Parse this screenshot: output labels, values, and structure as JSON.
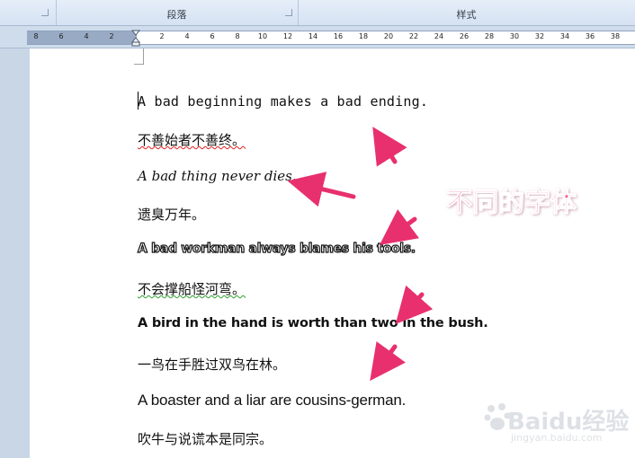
{
  "ribbon": {
    "groups": [
      {
        "label": ""
      },
      {
        "label": "段落"
      },
      {
        "label": "样式"
      }
    ]
  },
  "ruler": {
    "ticks": [
      "8",
      "6",
      "4",
      "2",
      "2",
      "4",
      "6",
      "8",
      "10",
      "12",
      "14",
      "16",
      "18",
      "20",
      "22",
      "24",
      "26",
      "28",
      "30",
      "32",
      "34",
      "36",
      "38"
    ]
  },
  "document": {
    "lines": [
      "A bad beginning makes a bad ending.",
      "不善始者不善终。",
      "A bad thing never dies.",
      "遗臭万年。",
      "A bad workman always blames his tools.",
      "不会撑船怪河弯。",
      "A bird in the hand is worth than two in the bush.",
      "一鸟在手胜过双鸟在林。",
      "A boaster and a liar are cousins-german.",
      "吹牛与说谎本是同宗。"
    ]
  },
  "annotation": {
    "text": "不同的字体",
    "color": "#f2468a"
  },
  "watermark": {
    "brand": "Baidu经验",
    "url": "jingyan.baidu.com"
  },
  "colors": {
    "arrow": "#e8306e",
    "ruler_margin": "#98aac4"
  }
}
